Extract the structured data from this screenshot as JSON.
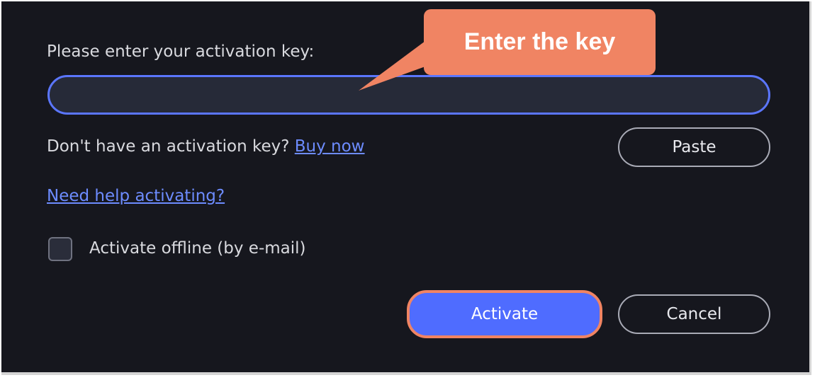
{
  "dialog": {
    "prompt_label": "Please enter your activation key:",
    "key_value": "",
    "no_key_text": "Don't have an activation key?",
    "buy_now_link": "Buy now",
    "paste_button": "Paste",
    "help_link": "Need help activating?",
    "offline_label": "Activate offline (by e-mail)",
    "offline_checked": false,
    "activate_button": "Activate",
    "cancel_button": "Cancel"
  },
  "callout": {
    "text": "Enter the key"
  },
  "colors": {
    "background": "#16171e",
    "accent": "#4f6cff",
    "input_border": "#5b76ff",
    "link": "#6d8cff",
    "callout": "#f08463"
  }
}
